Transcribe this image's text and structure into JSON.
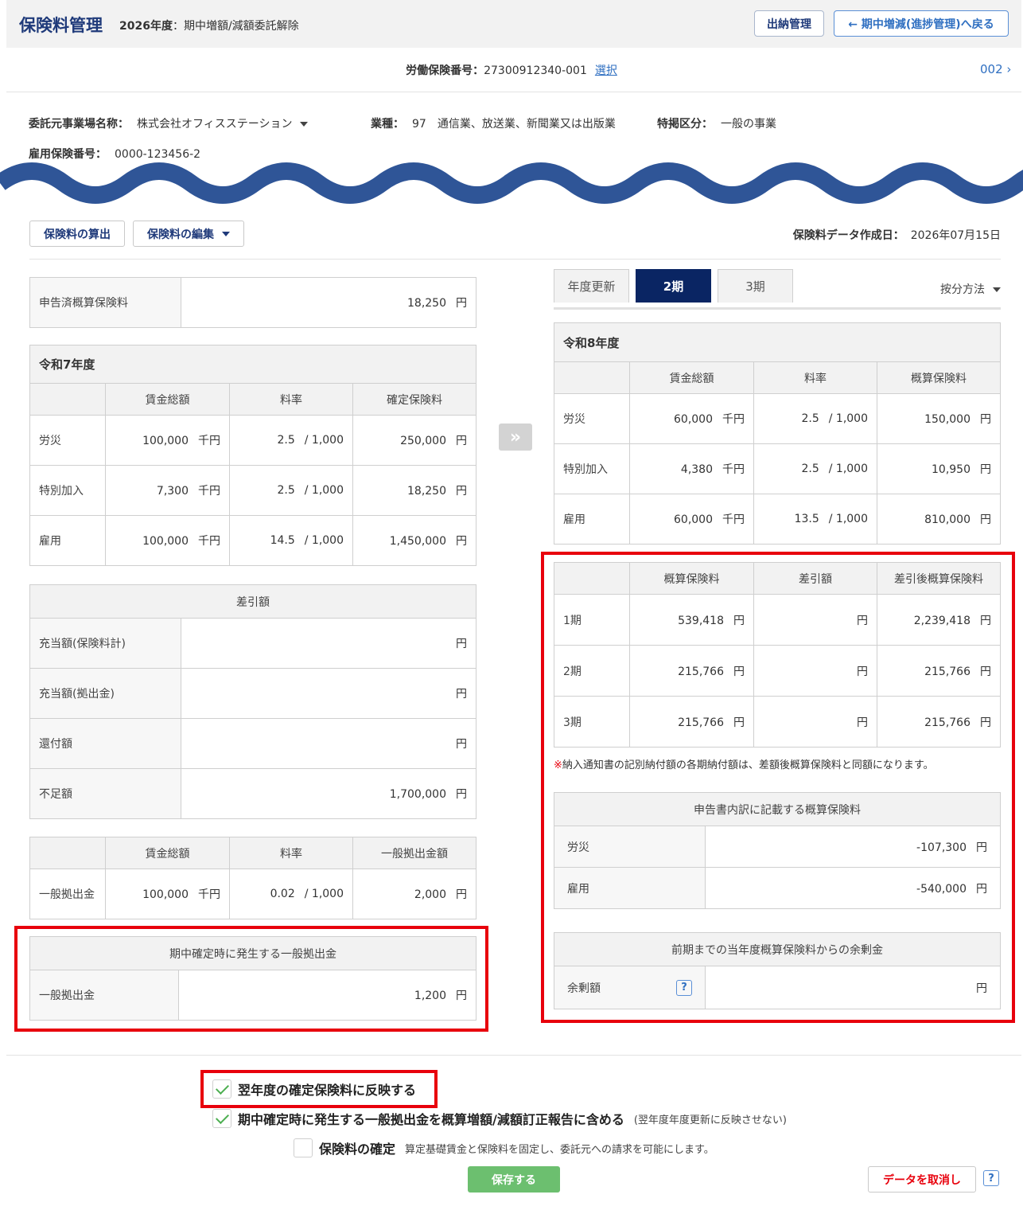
{
  "header": {
    "title": "保険料管理",
    "fiscal_year": "2026年度",
    "sep": "：",
    "description": "期中増額/減額委託解除",
    "btn_suino": "出納管理",
    "btn_back": "← 期中増減(進捗管理)へ戻る"
  },
  "roudou": {
    "label": "労働保険番号：",
    "value": "27300912340-001",
    "select_link": "選択",
    "pager": "002 ›"
  },
  "office": {
    "name_label": "委託元事業場名称：",
    "name_value": "株式会社オフィスステーション",
    "gyoshu_label": "業種：",
    "gyoshu_value": "97　通信業、放送業、新聞業又は出版業",
    "tokkei_label": "特掲区分：",
    "tokkei_value": "一般の事業",
    "koyo_label": "雇用保険番号：",
    "koyo_value": "0000-123456-2"
  },
  "toolbar": {
    "calc_button": "保険料の算出",
    "edit_button": "保険料の編集",
    "date_label": "保険料データ作成日：",
    "date_value": "2026年07月15日"
  },
  "left": {
    "shinkoku": {
      "label": "申告済概算保険料",
      "value": "18,250",
      "unit": "円"
    },
    "r7": {
      "title": "令和7年度",
      "headers": [
        "賃金総額",
        "料率",
        "確定保険料"
      ],
      "rows": [
        {
          "label": "労災",
          "wage": "100,000",
          "wage_unit": "千円",
          "rate": "2.5",
          "rate_unit": "/ 1,000",
          "amount": "250,000",
          "amount_unit": "円"
        },
        {
          "label": "特別加入",
          "wage": "7,300",
          "wage_unit": "千円",
          "rate": "2.5",
          "rate_unit": "/ 1,000",
          "amount": "18,250",
          "amount_unit": "円"
        },
        {
          "label": "雇用",
          "wage": "100,000",
          "wage_unit": "千円",
          "rate": "14.5",
          "rate_unit": "/ 1,000",
          "amount": "1,450,000",
          "amount_unit": "円"
        }
      ]
    },
    "sashihiki": {
      "title": "差引額",
      "rows": [
        {
          "label": "充当額(保険料計)",
          "value": "",
          "unit": "円"
        },
        {
          "label": "充当額(拠出金)",
          "value": "",
          "unit": "円"
        },
        {
          "label": "還付額",
          "value": "",
          "unit": "円"
        },
        {
          "label": "不足額",
          "value": "1,700,000",
          "unit": "円"
        }
      ]
    },
    "kyoshutsu": {
      "headers": [
        "賃金総額",
        "料率",
        "一般拠出金額"
      ],
      "row": {
        "label": "一般拠出金",
        "wage": "100,000",
        "wage_unit": "千円",
        "rate": "0.02",
        "rate_unit": "/ 1,000",
        "amount": "2,000",
        "amount_unit": "円"
      }
    },
    "kichu": {
      "title": "期中確定時に発生する一般拠出金",
      "label": "一般拠出金",
      "value": "1,200",
      "unit": "円"
    }
  },
  "right": {
    "tabs": [
      "年度更新",
      "2期",
      "3期"
    ],
    "anbun": "按分方法",
    "r8": {
      "title": "令和8年度",
      "headers": [
        "賃金総額",
        "料率",
        "概算保険料"
      ],
      "rows": [
        {
          "label": "労災",
          "wage": "60,000",
          "wage_unit": "千円",
          "rate": "2.5",
          "rate_unit": "/ 1,000",
          "amount": "150,000",
          "amount_unit": "円"
        },
        {
          "label": "特別加入",
          "wage": "4,380",
          "wage_unit": "千円",
          "rate": "2.5",
          "rate_unit": "/ 1,000",
          "amount": "10,950",
          "amount_unit": "円"
        },
        {
          "label": "雇用",
          "wage": "60,000",
          "wage_unit": "千円",
          "rate": "13.5",
          "rate_unit": "/ 1,000",
          "amount": "810,000",
          "amount_unit": "円"
        }
      ]
    },
    "periods": {
      "headers": [
        "概算保険料",
        "差引額",
        "差引後概算保険料"
      ],
      "rows": [
        {
          "label": "1期",
          "gaisan": "539,418",
          "sashihiki": "",
          "after": "2,239,418",
          "unit": "円"
        },
        {
          "label": "2期",
          "gaisan": "215,766",
          "sashihiki": "",
          "after": "215,766",
          "unit": "円"
        },
        {
          "label": "3期",
          "gaisan": "215,766",
          "sashihiki": "",
          "after": "215,766",
          "unit": "円"
        }
      ]
    },
    "note_mark": "※",
    "note_text": "納入通知書の記別納付額の各期納付額は、差額後概算保険料と同額になります。",
    "uchiwake": {
      "title": "申告書内訳に記載する概算保険料",
      "rows": [
        {
          "label": "労災",
          "value": "-107,300",
          "unit": "円"
        },
        {
          "label": "雇用",
          "value": "-540,000",
          "unit": "円"
        }
      ]
    },
    "yojo": {
      "title": "前期までの当年度概算保険料からの余剰金",
      "label": "余剰額",
      "help": "?",
      "value": "",
      "unit": "円"
    }
  },
  "footer": {
    "check1": {
      "label": "翌年度の確定保険料に反映する",
      "checked": true
    },
    "check2": {
      "label": "期中確定時に発生する一般拠出金を概算増額/減額訂正報告に含める",
      "sub": "(翌年度年度更新に反映させない)",
      "checked": true
    },
    "check3": {
      "label": "保険料の確定",
      "sub": "算定基礎賃金と保険料を固定し、委託元への請求を可能にします。",
      "checked": false
    },
    "save": "保存する",
    "cancel": "データを取消し",
    "help": "?"
  },
  "colors": {
    "accent": "#1f3a7a",
    "active_tab": "#0a2563",
    "highlight": "#e8000c",
    "save": "#6cbf6f",
    "wave": "#2f5597"
  }
}
